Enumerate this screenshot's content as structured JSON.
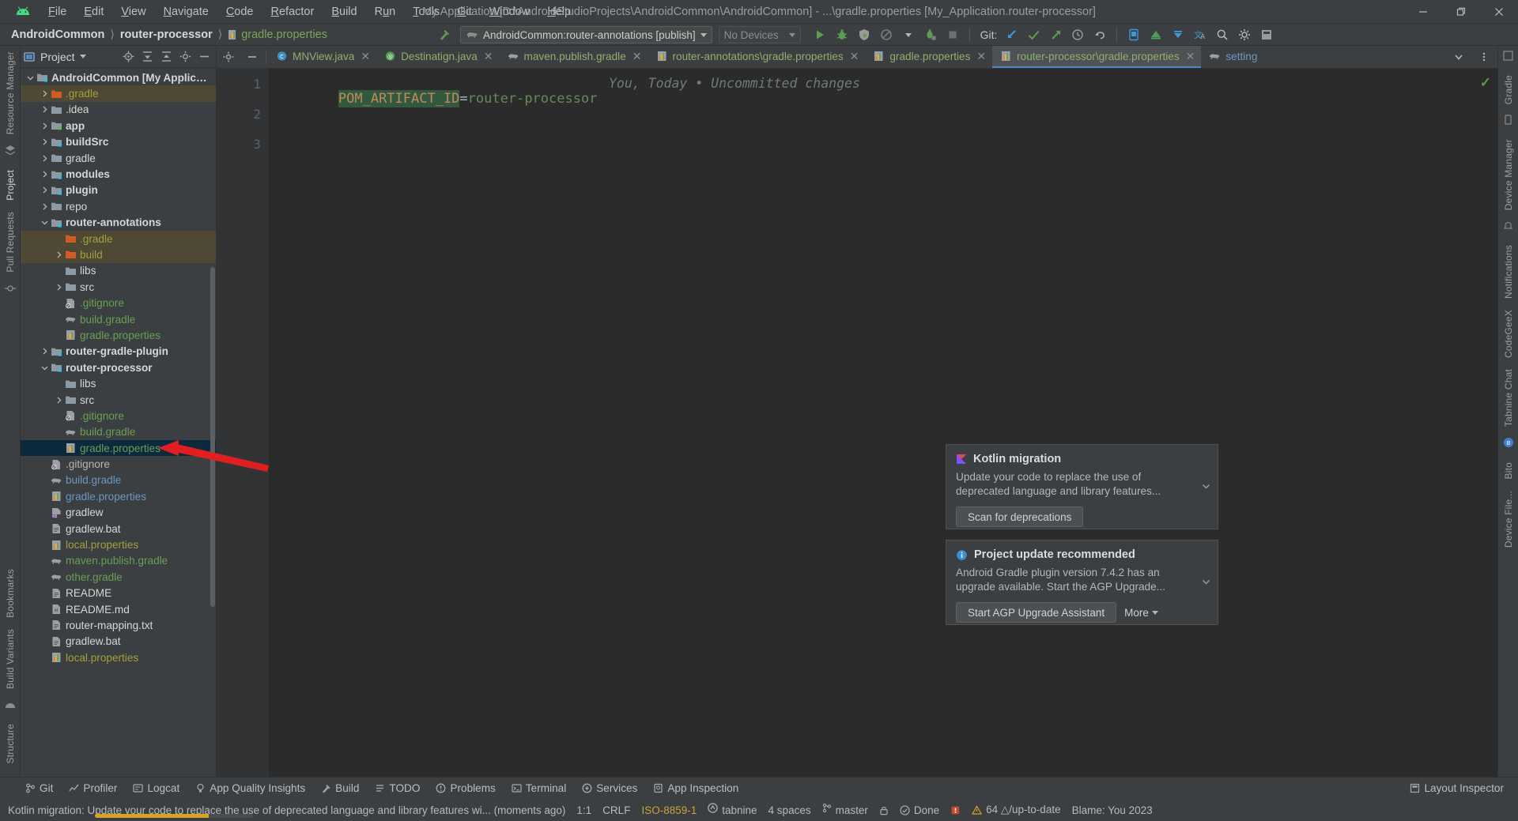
{
  "titlebar": {
    "window_title": "My Application [D:\\AndroidStudioProjects\\AndroidCommon\\AndroidCommon] - ...\\gradle.properties [My_Application.router-processor]",
    "minimize": "–",
    "maximize": "❐",
    "close": "✕",
    "menu": [
      {
        "label": "File"
      },
      {
        "label": "Edit"
      },
      {
        "label": "View"
      },
      {
        "label": "Navigate"
      },
      {
        "label": "Code"
      },
      {
        "label": "Refactor"
      },
      {
        "label": "Build"
      },
      {
        "label": "Run"
      },
      {
        "label": "Tools"
      },
      {
        "label": "Git"
      },
      {
        "label": "Window"
      },
      {
        "label": "Help"
      }
    ]
  },
  "navbar": {
    "breadcrumbs": [
      {
        "label": "AndroidCommon",
        "type": "project"
      },
      {
        "label": "router-processor",
        "type": "module"
      },
      {
        "label": "gradle.properties",
        "type": "file"
      }
    ],
    "run_config": "AndroidCommon:router-annotations [publish]",
    "device_selector": "No Devices",
    "git_label": "Git:",
    "icons": [
      "run-icon",
      "debug-icon",
      "run-coverage-icon",
      "profiler-icon",
      "attach-debugger-icon",
      "stop-icon",
      "git-update-icon",
      "git-commit-icon",
      "git-push-icon",
      "git-history-icon",
      "undo-icon",
      "avd-manager-icon",
      "sdk-manager-icon",
      "device-file-explorer-icon",
      "translate-icon",
      "search-everywhere-icon",
      "settings-icon",
      "layout-inspector-icon"
    ]
  },
  "left_strip": {
    "items": [
      {
        "label": "Resource Manager"
      },
      {
        "label": "Project",
        "active": true
      },
      {
        "label": "Pull Requests"
      },
      {
        "label": "Bookmarks"
      },
      {
        "label": "Build Variants"
      },
      {
        "label": "Structure"
      }
    ]
  },
  "right_strip": {
    "items": [
      {
        "label": "Gradle"
      },
      {
        "label": "Device Manager"
      },
      {
        "label": "Notifications"
      },
      {
        "label": "CodeGeeX"
      },
      {
        "label": "Tabnine Chat"
      },
      {
        "label": "Bito"
      },
      {
        "label": "Device File..."
      }
    ]
  },
  "project_panel": {
    "title": "Project",
    "toolbar_icons": [
      "locate-icon",
      "expand-all-icon",
      "collapse-all-icon",
      "settings-icon",
      "hide-icon"
    ],
    "tree": [
      {
        "depth": 0,
        "twist": "v",
        "icon": "module-folder",
        "label": "AndroidCommon [My Application]",
        "color": "c-white",
        "bold": true
      },
      {
        "depth": 1,
        "twist": ">",
        "icon": "folder-orange",
        "label": ".gradle",
        "color": "c-olive",
        "bold": false,
        "row": "hl-gradle"
      },
      {
        "depth": 1,
        "twist": ">",
        "icon": "folder-gray",
        "label": ".idea",
        "color": "c-white",
        "bold": false
      },
      {
        "depth": 1,
        "twist": ">",
        "icon": "module-folder-green",
        "label": "app",
        "color": "c-white",
        "bold": true
      },
      {
        "depth": 1,
        "twist": ">",
        "icon": "module-folder",
        "label": "buildSrc",
        "color": "c-white",
        "bold": true
      },
      {
        "depth": 1,
        "twist": ">",
        "icon": "folder-gray",
        "label": "gradle",
        "color": "c-white",
        "bold": false
      },
      {
        "depth": 1,
        "twist": ">",
        "icon": "module-folder",
        "label": "modules",
        "color": "c-white",
        "bold": true
      },
      {
        "depth": 1,
        "twist": ">",
        "icon": "module-folder",
        "label": "plugin",
        "color": "c-white",
        "bold": true
      },
      {
        "depth": 1,
        "twist": ">",
        "icon": "folder-gray",
        "label": "repo",
        "color": "c-white",
        "bold": false
      },
      {
        "depth": 1,
        "twist": "v",
        "icon": "module-folder",
        "label": "router-annotations",
        "color": "c-white",
        "bold": true
      },
      {
        "depth": 2,
        "twist": "",
        "icon": "folder-orange",
        "label": ".gradle",
        "color": "c-olive",
        "bold": false,
        "row": "hl-gradle"
      },
      {
        "depth": 2,
        "twist": ">",
        "icon": "folder-orange",
        "label": "build",
        "color": "c-olive",
        "bold": false,
        "row": "hl-gradle"
      },
      {
        "depth": 2,
        "twist": "",
        "icon": "folder-gray",
        "label": "libs",
        "color": "c-white",
        "bold": false
      },
      {
        "depth": 2,
        "twist": ">",
        "icon": "folder-gray",
        "label": "src",
        "color": "c-white",
        "bold": false
      },
      {
        "depth": 2,
        "twist": "",
        "icon": "gitignore-file",
        "label": ".gitignore",
        "color": "c-green",
        "bold": false
      },
      {
        "depth": 2,
        "twist": "",
        "icon": "gradle-file",
        "label": "build.gradle",
        "color": "c-green",
        "bold": false
      },
      {
        "depth": 2,
        "twist": "",
        "icon": "properties-file",
        "label": "gradle.properties",
        "color": "c-green",
        "bold": false
      },
      {
        "depth": 1,
        "twist": ">",
        "icon": "module-folder",
        "label": "router-gradle-plugin",
        "color": "c-white",
        "bold": true
      },
      {
        "depth": 1,
        "twist": "v",
        "icon": "module-folder",
        "label": "router-processor",
        "color": "c-white",
        "bold": true
      },
      {
        "depth": 2,
        "twist": "",
        "icon": "folder-gray",
        "label": "libs",
        "color": "c-white",
        "bold": false
      },
      {
        "depth": 2,
        "twist": ">",
        "icon": "folder-gray",
        "label": "src",
        "color": "c-white",
        "bold": false
      },
      {
        "depth": 2,
        "twist": "",
        "icon": "gitignore-file",
        "label": ".gitignore",
        "color": "c-green",
        "bold": false
      },
      {
        "depth": 2,
        "twist": "",
        "icon": "gradle-file",
        "label": "build.gradle",
        "color": "c-green",
        "bold": false
      },
      {
        "depth": 2,
        "twist": "",
        "icon": "properties-file",
        "label": "gradle.properties",
        "color": "c-green",
        "bold": false,
        "row": "sel"
      },
      {
        "depth": 1,
        "twist": "",
        "icon": "gitignore-file",
        "label": ".gitignore",
        "color": "c-gray",
        "bold": false
      },
      {
        "depth": 1,
        "twist": "",
        "icon": "gradle-file",
        "label": "build.gradle",
        "color": "c-blue",
        "bold": false
      },
      {
        "depth": 1,
        "twist": "",
        "icon": "properties-file",
        "label": "gradle.properties",
        "color": "c-blue",
        "bold": false
      },
      {
        "depth": 1,
        "twist": "",
        "icon": "exec-file",
        "label": "gradlew",
        "color": "c-white",
        "bold": false
      },
      {
        "depth": 1,
        "twist": "",
        "icon": "text-file",
        "label": "gradlew.bat",
        "color": "c-white",
        "bold": false
      },
      {
        "depth": 1,
        "twist": "",
        "icon": "properties-file",
        "label": "local.properties",
        "color": "c-olive",
        "bold": false
      },
      {
        "depth": 1,
        "twist": "",
        "icon": "gradle-file",
        "label": "maven.publish.gradle",
        "color": "c-green",
        "bold": false
      },
      {
        "depth": 1,
        "twist": "",
        "icon": "gradle-file",
        "label": "other.gradle",
        "color": "c-green",
        "bold": false
      },
      {
        "depth": 1,
        "twist": "",
        "icon": "text-file",
        "label": "README",
        "color": "c-white",
        "bold": false
      },
      {
        "depth": 1,
        "twist": "",
        "icon": "md-file",
        "label": "README.md",
        "color": "c-white",
        "bold": false
      },
      {
        "depth": 1,
        "twist": "",
        "icon": "text-file",
        "label": "router-mapping.txt",
        "color": "c-white",
        "bold": false
      },
      {
        "depth": 1,
        "twist": "",
        "icon": "text-file",
        "label": "gradlew.bat",
        "color": "c-white",
        "bold": false
      },
      {
        "depth": 1,
        "twist": "",
        "icon": "properties-file",
        "label": "local.properties",
        "color": "c-olive",
        "bold": false
      }
    ]
  },
  "tabs": [
    {
      "label": "MNView.java",
      "icon": "java-class-icon",
      "color": "green",
      "active": false
    },
    {
      "label": "Destinatign.java",
      "icon": "java-annotation-icon",
      "color": "green",
      "active": false
    },
    {
      "label": "maven.publish.gradle",
      "icon": "gradle-icon",
      "color": "green",
      "active": false
    },
    {
      "label": "router-annotations\\gradle.properties",
      "icon": "properties-icon",
      "color": "green",
      "active": false
    },
    {
      "label": "gradle.properties",
      "icon": "properties-icon",
      "color": "green",
      "active": false
    },
    {
      "label": "router-processor\\gradle.properties",
      "icon": "properties-icon",
      "color": "green",
      "active": true
    },
    {
      "label": "setting",
      "icon": "gradle-icon",
      "color": "blue",
      "active": false
    }
  ],
  "editor": {
    "line_numbers": [
      "1",
      "2",
      "3"
    ],
    "code_key": "POM_ARTIFACT_ID",
    "code_eq": "=",
    "code_value": "router-processor",
    "annotation": "You, Today • Uncommitted changes",
    "inspection_status": "✓"
  },
  "notifications": [
    {
      "icon": "kotlin-icon",
      "title": "Kotlin migration",
      "body": "Update your code to replace the use of deprecated language and library features...",
      "action": "Scan for deprecations",
      "more": ""
    },
    {
      "icon": "info-icon",
      "title": "Project update recommended",
      "body": "Android Gradle plugin version 7.4.2 has an upgrade available. Start the AGP Upgrade...",
      "action": "Start AGP Upgrade Assistant",
      "more": "More"
    }
  ],
  "bottom_bar": {
    "left": [
      {
        "label": "Git",
        "icon": "git-icon"
      },
      {
        "label": "Profiler",
        "icon": "profiler-icon"
      },
      {
        "label": "Logcat",
        "icon": "logcat-icon"
      },
      {
        "label": "App Quality Insights",
        "icon": "insights-icon"
      },
      {
        "label": "Build",
        "icon": "build-icon"
      },
      {
        "label": "TODO",
        "icon": "todo-icon"
      },
      {
        "label": "Problems",
        "icon": "problems-icon"
      },
      {
        "label": "Terminal",
        "icon": "terminal-icon"
      },
      {
        "label": "Services",
        "icon": "services-icon"
      },
      {
        "label": "App Inspection",
        "icon": "app-inspection-icon"
      }
    ],
    "right": [
      {
        "label": "Layout Inspector",
        "icon": "layout-inspector-icon"
      }
    ]
  },
  "statusbar": {
    "message": "Kotlin migration: Update your code to replace the use of deprecated language and library features wi... (moments ago)",
    "caret": "1:1",
    "line_sep": "CRLF",
    "encoding": "ISO-8859-1",
    "plugin": "tabnine",
    "indent": "4 spaces",
    "branch": "master",
    "lock_icon": "lock-icon",
    "done": "Done",
    "memory": "64 △/up-to-date",
    "blame": "Blame: You 2023"
  },
  "colors": {
    "accent_blue": "#4a88c7",
    "green": "#6a9e55",
    "selection": "#0d293e",
    "arrow_red": "#e02020",
    "warn_yellow": "#d8a227",
    "bg": "#3c3f41",
    "editor_bg": "#2b2b2b"
  }
}
